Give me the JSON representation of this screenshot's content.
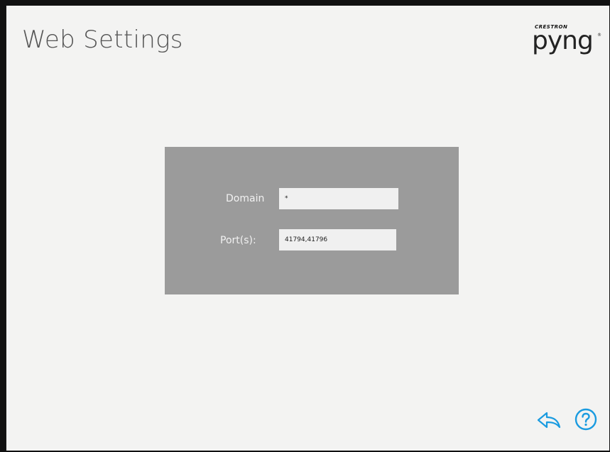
{
  "header": {
    "title": "Web Settings"
  },
  "logo": {
    "sub": "CRESTRON",
    "main": "pyng",
    "reg": "®"
  },
  "form": {
    "domain": {
      "label": "Domain",
      "value": "*"
    },
    "ports": {
      "label": "Port(s):",
      "value": "41794,41796"
    }
  },
  "footer": {
    "back_icon": "back-arrow-icon",
    "help_icon": "question-circle-icon"
  },
  "colors": {
    "accent": "#1a9be0",
    "panel": "#9b9b9b",
    "background": "#f3f3f2"
  }
}
